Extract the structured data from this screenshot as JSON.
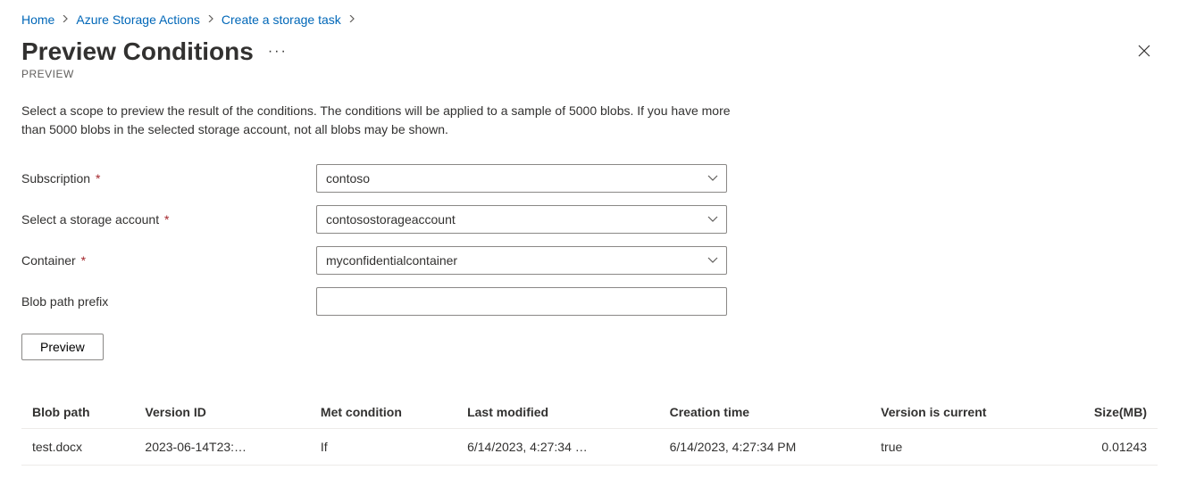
{
  "breadcrumb": [
    {
      "label": "Home"
    },
    {
      "label": "Azure Storage Actions"
    },
    {
      "label": "Create a storage task"
    }
  ],
  "header": {
    "title": "Preview Conditions",
    "subtitle": "PREVIEW",
    "description": "Select a scope to preview the result of the conditions. The conditions will be applied to a sample of 5000 blobs. If you have more than 5000 blobs in the selected storage account, not all blobs may be shown."
  },
  "form": {
    "subscription": {
      "label": "Subscription",
      "value": "contoso"
    },
    "storage_account": {
      "label": "Select a storage account",
      "value": "contosostorageaccount"
    },
    "container": {
      "label": "Container",
      "value": "myconfidentialcontainer"
    },
    "blob_prefix": {
      "label": "Blob path prefix",
      "value": ""
    },
    "preview_button": "Preview"
  },
  "table": {
    "columns": [
      "Blob path",
      "Version ID",
      "Met condition",
      "Last modified",
      "Creation time",
      "Version is current",
      "Size(MB)"
    ],
    "rows": [
      {
        "blob_path": "test.docx",
        "version_id": "2023-06-14T23:…",
        "met_condition": "If",
        "last_modified": "6/14/2023, 4:27:34 …",
        "creation_time": "6/14/2023, 4:27:34 PM",
        "version_is_current": "true",
        "size_mb": "0.01243"
      }
    ]
  }
}
